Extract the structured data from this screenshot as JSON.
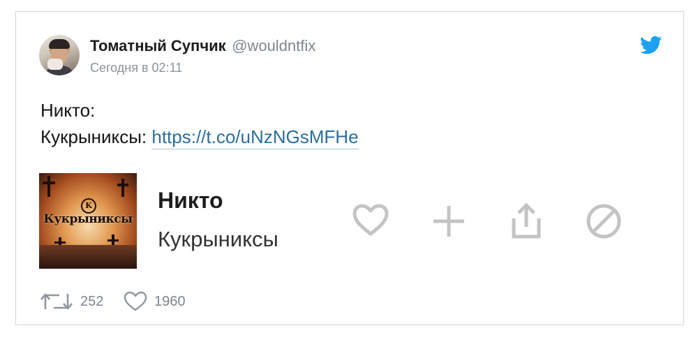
{
  "tweet": {
    "author": {
      "display_name": "Томатный Супчик",
      "handle": "@wouldntfix"
    },
    "timestamp": "Сегодня в 02:11",
    "text_line1": "Никто:",
    "text_line2_prefix": "Кукрыниксы: ",
    "link": "https://t.co/uNzNGsMFHe"
  },
  "music_card": {
    "cover_text": "Кукрыниксы",
    "track_title": "Никто",
    "artist": "Кукрыниксы"
  },
  "stats": {
    "retweets": "252",
    "likes": "1960"
  },
  "colors": {
    "twitter_blue": "#1da1f2",
    "link": "#2b6e9e",
    "muted": "#7d868f",
    "action_gray": "#c4c4c4"
  },
  "icons": {
    "brand": "twitter-bird-icon",
    "actions": [
      "heart-outline-icon",
      "plus-icon",
      "share-icon",
      "block-icon"
    ],
    "stats": [
      "retweet-icon",
      "heart-outline-icon"
    ]
  }
}
